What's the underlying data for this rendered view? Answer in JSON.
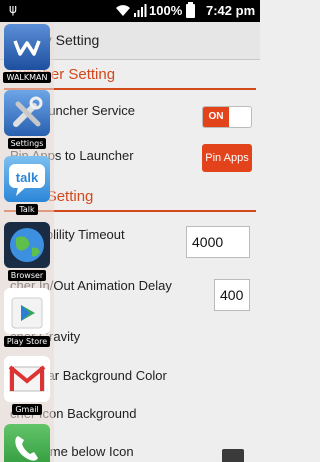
{
  "status_bar": {
    "battery_percent": "100%",
    "time": "7:42 pm",
    "icons": [
      "usb-icon",
      "wifi-icon",
      "signal-icon",
      "battery-icon"
    ]
  },
  "title_bar": {
    "title": "nity Setting"
  },
  "sections": {
    "launcher": "auncher Setting",
    "appearance": "ance Setting"
  },
  "rows": {
    "launcher_service": "nity Launcher Service",
    "pin_apps": "Pin Apps to Launcher",
    "visibility_timeout": "er Visiblility Timeout",
    "animation_delay": "cher In/Out Animation Delay",
    "gravity": "cher Gravity",
    "bar_bg_color": "cher Bar Background Color",
    "icon_bg": "cher Icon Background",
    "app_name_below": "app name below Icon"
  },
  "controls": {
    "toggle_label": "ON",
    "pin_apps_button": "Pin Apps",
    "timeout_value": "4000",
    "delay_value": "400"
  },
  "dock": {
    "apps": [
      {
        "label": "WALKMAN",
        "icon": "walkman-icon"
      },
      {
        "label": "Settings",
        "icon": "settings-icon"
      },
      {
        "label": "Talk",
        "icon": "talk-icon"
      },
      {
        "label": "Browser",
        "icon": "browser-icon"
      },
      {
        "label": "Play Store",
        "icon": "play-store-icon"
      },
      {
        "label": "Gmail",
        "icon": "gmail-icon"
      },
      {
        "label": "",
        "icon": "phone-icon"
      }
    ]
  },
  "colors": {
    "accent": "#e2431b",
    "section": "#d2491b"
  }
}
